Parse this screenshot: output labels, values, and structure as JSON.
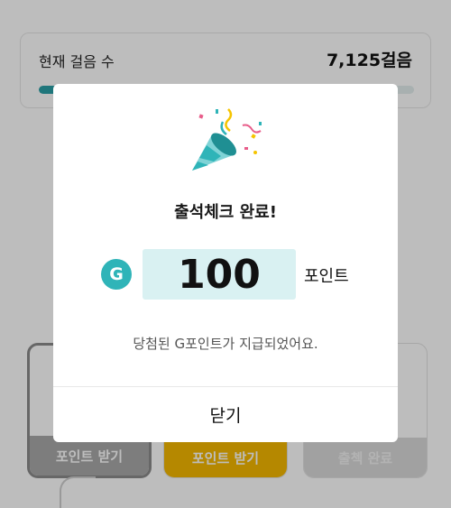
{
  "steps": {
    "label": "현재 걸음 수",
    "value": "7,125걸음",
    "progress_fraction": 0.72,
    "progress_color": "#2aa0a6"
  },
  "rewards": [
    {
      "button_label": "포인트 받기",
      "state": "done",
      "color": "#a9a9a9"
    },
    {
      "button_label": "포인트 받기",
      "state": "active",
      "color": "#f5b800"
    },
    {
      "button_label": "출첵 완료",
      "state": "disabled",
      "color": "#d9d9d9"
    }
  ],
  "modal": {
    "icon": "party-popper-icon",
    "title": "출석체크 완료!",
    "badge_letter": "G",
    "amount": "100",
    "unit": "포인트",
    "message": "당첨된 G포인트가 지급되었어요.",
    "close_label": "닫기",
    "accent_color": "#2fb4b8"
  }
}
